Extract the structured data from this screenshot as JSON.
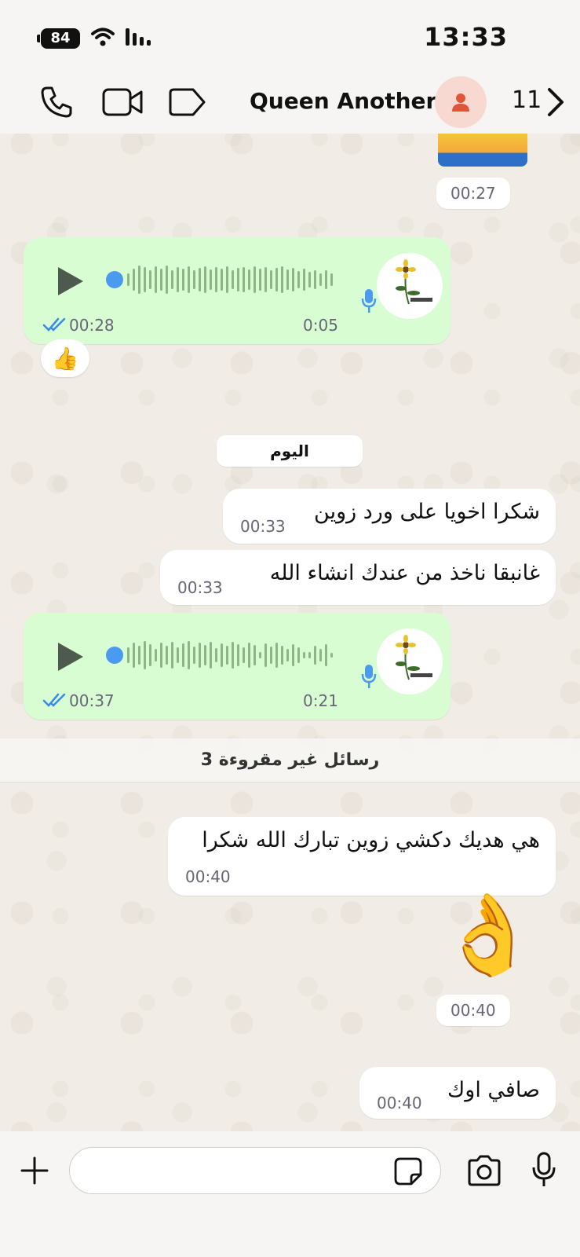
{
  "status_bar": {
    "battery": "84",
    "time": "13:33"
  },
  "header": {
    "contact_name": "Queen Another",
    "unread_count": "11"
  },
  "chat": {
    "sticker_time": "00:27",
    "voice_1": {
      "sent_time": "00:28",
      "duration": "0:05",
      "reaction": "👍"
    },
    "day_separator": "اليوم",
    "messages_in_1": [
      {
        "text": "شكرا اخويا على ورد زوين",
        "time": "00:33"
      },
      {
        "text": "غانبقا ناخذ من عندك انشاء الله",
        "time": "00:33"
      }
    ],
    "voice_2": {
      "sent_time": "00:37",
      "duration": "0:21"
    },
    "unread_banner": "3 رسائل غير مقروءة",
    "message_3": {
      "text": "هي هديك دكشي زوين تبارك الله شكرا",
      "time": "00:40"
    },
    "emoji_message": {
      "emoji": "👌",
      "time": "00:40"
    },
    "message_4": {
      "text": "صافي اوك",
      "time": "00:40"
    }
  },
  "input_bar": {
    "placeholder": ""
  },
  "colors": {
    "outgoing_bubble": "#d9fdd3",
    "incoming_bubble": "#ffffff",
    "play_blue": "#4a9bf0"
  }
}
